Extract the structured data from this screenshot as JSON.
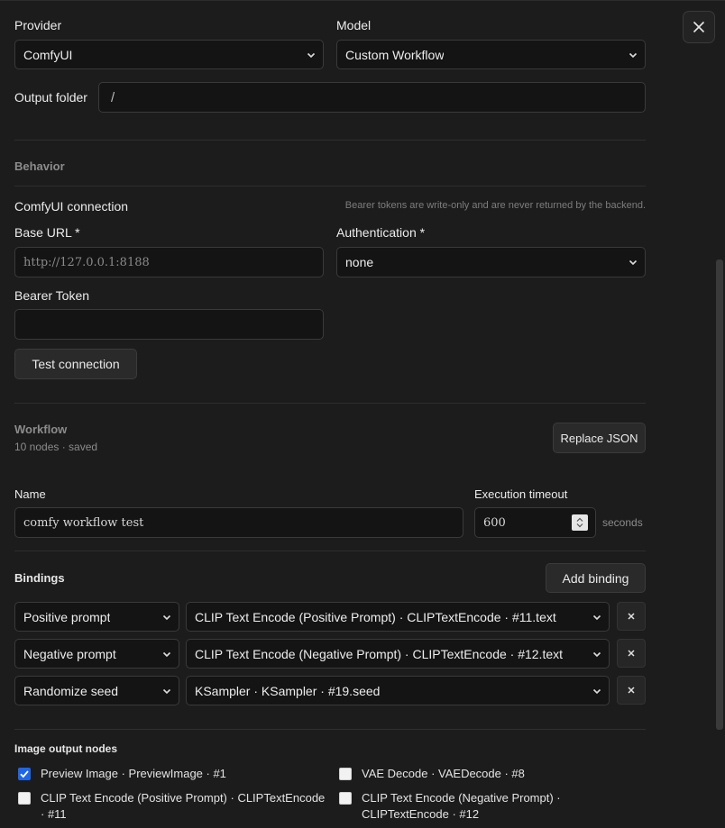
{
  "provider": {
    "label": "Provider",
    "value": "ComfyUI"
  },
  "model": {
    "label": "Model",
    "value": "Custom Workflow"
  },
  "output_folder": {
    "label": "Output folder",
    "value": "/"
  },
  "behavior": {
    "title": "Behavior"
  },
  "connection": {
    "title": "ComfyUI connection",
    "hint": "Bearer tokens are write-only and are never returned by the backend.",
    "base_url_label": "Base URL *",
    "base_url_placeholder": "http://127.0.0.1:8188",
    "auth_label": "Authentication *",
    "auth_value": "none",
    "bearer_label": "Bearer Token",
    "bearer_value": "",
    "test_button": "Test connection"
  },
  "workflow": {
    "title": "Workflow",
    "status": "10 nodes · saved",
    "replace_button": "Replace JSON",
    "name_label": "Name",
    "name_value": "comfy workflow test",
    "timeout_label": "Execution timeout",
    "timeout_value": "600",
    "timeout_unit": "seconds"
  },
  "bindings": {
    "title": "Bindings",
    "add_button": "Add binding",
    "rows": [
      {
        "kind": "Positive prompt",
        "target": "CLIP Text Encode (Positive Prompt) · CLIPTextEncode · #11.text"
      },
      {
        "kind": "Negative prompt",
        "target": "CLIP Text Encode (Negative Prompt) · CLIPTextEncode · #12.text"
      },
      {
        "kind": "Randomize seed",
        "target": "KSampler · KSampler · #19.seed"
      }
    ],
    "remove_label": "×"
  },
  "image_output": {
    "title": "Image output nodes",
    "items": [
      {
        "label": "Preview Image · PreviewImage · #1",
        "checked": true
      },
      {
        "label": "VAE Decode · VAEDecode · #8",
        "checked": false
      },
      {
        "label": "CLIP Text Encode (Positive Prompt) · CLIPTextEncode · #11",
        "checked": false
      },
      {
        "label": "CLIP Text Encode (Negative Prompt) · CLIPTextEncode · #12",
        "checked": false
      }
    ]
  },
  "icons": {
    "close": "close-icon",
    "chevron": "chevron-down-icon",
    "check": "check-icon",
    "stepper": "stepper-icon"
  },
  "colors": {
    "background": "#1c1c1c",
    "accent": "#1e66e8",
    "field": "#141414"
  }
}
